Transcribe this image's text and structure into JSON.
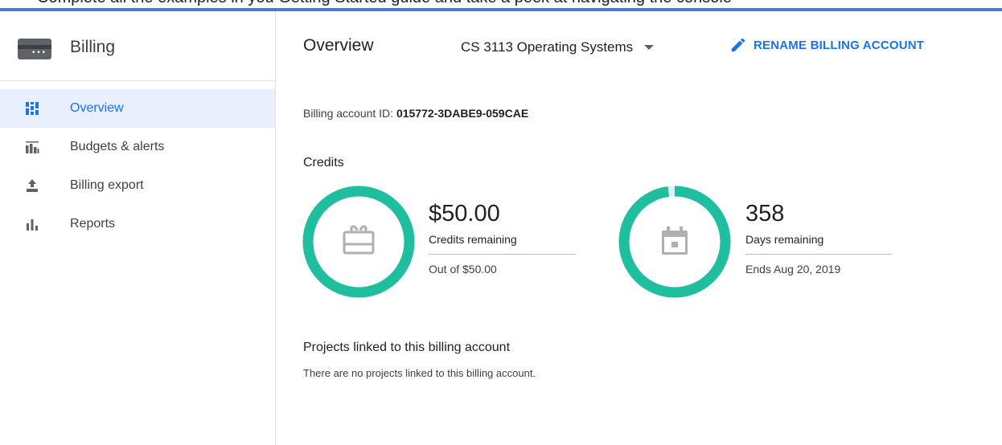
{
  "top_strip": {
    "text": "Complete all the examples in you Getting Started guide and take a peek at navigating the console"
  },
  "sidebar": {
    "title": "Billing",
    "items": [
      {
        "label": "Overview",
        "icon": "dashboard-icon",
        "active": true
      },
      {
        "label": "Budgets & alerts",
        "icon": "budget-chart-icon",
        "active": false
      },
      {
        "label": "Billing export",
        "icon": "upload-icon",
        "active": false
      },
      {
        "label": "Reports",
        "icon": "bar-chart-icon",
        "active": false
      }
    ]
  },
  "header": {
    "title": "Overview",
    "account_name": "CS 3113 Operating Systems",
    "rename_label": "RENAME BILLING ACCOUNT"
  },
  "account": {
    "id_label": "Billing account ID: ",
    "id_value": "015772-3DABE9-059CAE"
  },
  "credits": {
    "heading": "Credits",
    "amount": {
      "value": "$50.00",
      "label": "Credits remaining",
      "sub": "Out of $50.00",
      "icon": "gift-card-icon",
      "remaining_fraction": 1.0
    },
    "days": {
      "value": "358",
      "label": "Days remaining",
      "sub": "Ends Aug 20, 2019",
      "icon": "calendar-icon",
      "remaining_fraction": 0.98
    }
  },
  "projects": {
    "heading": "Projects linked to this billing account",
    "empty_text": "There are no projects linked to this billing account."
  },
  "colors": {
    "accent": "#1a73e8",
    "ring": "#1fbe9f",
    "ring_track": "#dff3ee",
    "active_nav_bg": "#e8f0fe",
    "top_accent": "#4a7bd0"
  }
}
